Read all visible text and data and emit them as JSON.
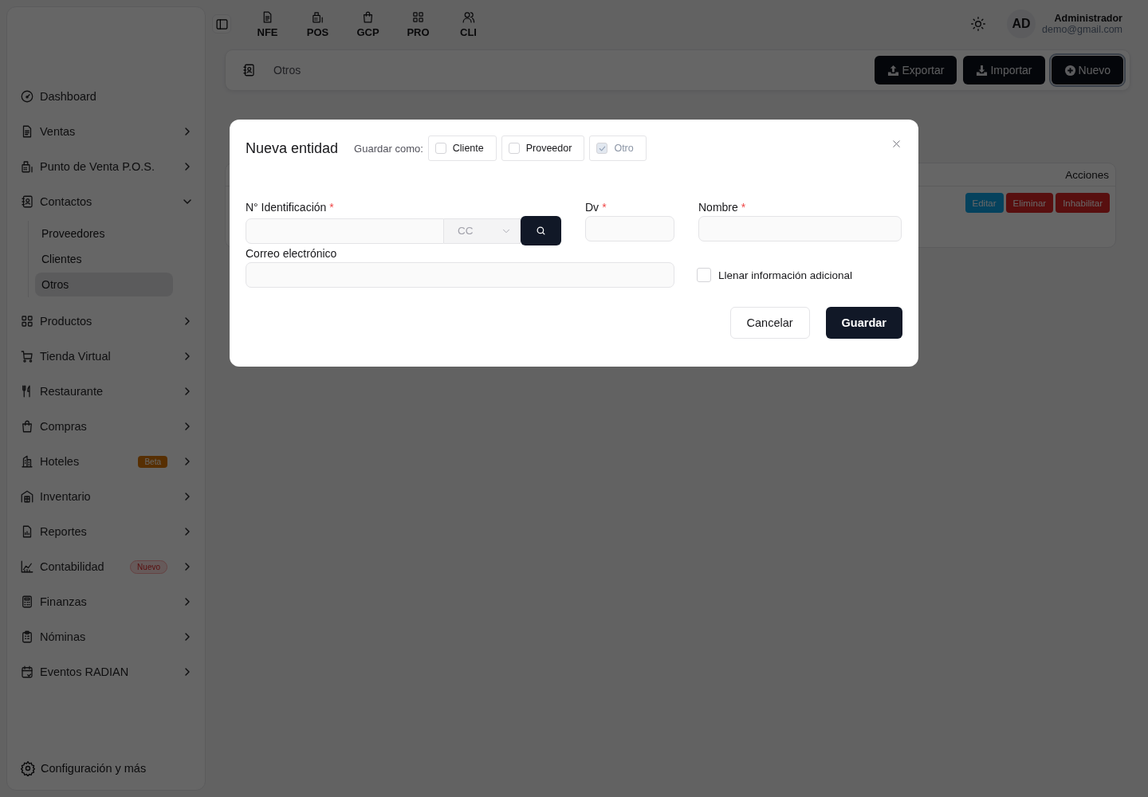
{
  "topbar": {
    "nav": [
      {
        "label": "NFE"
      },
      {
        "label": "POS"
      },
      {
        "label": "GCP"
      },
      {
        "label": "PRO"
      },
      {
        "label": "CLI"
      }
    ],
    "user": {
      "initials": "AD",
      "name": "Administrador",
      "email": "demo@gmail.com"
    }
  },
  "sidebar": {
    "items": [
      {
        "label": "Dashboard",
        "kind": "link"
      },
      {
        "label": "Ventas",
        "kind": "group",
        "expanded": false
      },
      {
        "label": "Punto de Venta P.O.S.",
        "kind": "group",
        "expanded": false
      },
      {
        "label": "Contactos",
        "kind": "group",
        "expanded": true,
        "children": [
          {
            "label": "Proveedores",
            "selected": false
          },
          {
            "label": "Clientes",
            "selected": false
          },
          {
            "label": "Otros",
            "selected": true
          }
        ]
      },
      {
        "label": "Productos",
        "kind": "group",
        "expanded": false
      },
      {
        "label": "Tienda Virtual",
        "kind": "group",
        "expanded": false
      },
      {
        "label": "Restaurante",
        "kind": "group",
        "expanded": false
      },
      {
        "label": "Compras",
        "kind": "group",
        "expanded": false
      },
      {
        "label": "Hoteles",
        "kind": "group",
        "expanded": false,
        "badge": {
          "text": "Beta",
          "kind": "beta"
        }
      },
      {
        "label": "Inventario",
        "kind": "group",
        "expanded": false
      },
      {
        "label": "Reportes",
        "kind": "group",
        "expanded": false
      },
      {
        "label": "Contabilidad",
        "kind": "group",
        "expanded": false,
        "badge": {
          "text": "Nuevo",
          "kind": "new"
        }
      },
      {
        "label": "Finanzas",
        "kind": "group",
        "expanded": false
      },
      {
        "label": "Nóminas",
        "kind": "group",
        "expanded": false
      },
      {
        "label": "Eventos RADIAN",
        "kind": "group",
        "expanded": false
      }
    ],
    "footer": "Configuración y más"
  },
  "page": {
    "title": "Otros",
    "actions": [
      {
        "label": "Exportar",
        "kind": "export",
        "focused": false
      },
      {
        "label": "Importar",
        "kind": "import",
        "focused": false
      },
      {
        "label": "Nuevo",
        "kind": "new",
        "focused": true
      }
    ]
  },
  "table": {
    "columns": [
      {
        "label": "Acciones"
      }
    ],
    "rows": [
      {
        "actions": [
          {
            "label": "Editar",
            "kind": "edit"
          },
          {
            "label": "Eliminar",
            "kind": "delete"
          },
          {
            "label": "Inhabilitar",
            "kind": "disable"
          }
        ]
      }
    ]
  },
  "modal": {
    "title": "Nueva entidad",
    "save_as_label": "Guardar como:",
    "save_as": [
      {
        "label": "Cliente",
        "checked": false,
        "disabled": false
      },
      {
        "label": "Proveedor",
        "checked": false,
        "disabled": false
      },
      {
        "label": "Otro",
        "checked": true,
        "disabled": true
      }
    ],
    "fields": [
      {
        "kind": "id",
        "label": "N° Identificación",
        "required_mark": "*",
        "type_value": "CC"
      },
      {
        "kind": "text",
        "label": "Dv",
        "required_mark": "*"
      },
      {
        "kind": "text",
        "label": "Nombre",
        "required_mark": "*"
      },
      {
        "kind": "wide",
        "label": "Correo electrónico"
      }
    ],
    "extra": {
      "label": "Llenar información adicional",
      "checked": false
    },
    "buttons": [
      {
        "label": "Cancelar",
        "kind": "secondary"
      },
      {
        "label": "Guardar",
        "kind": "primary"
      }
    ]
  }
}
